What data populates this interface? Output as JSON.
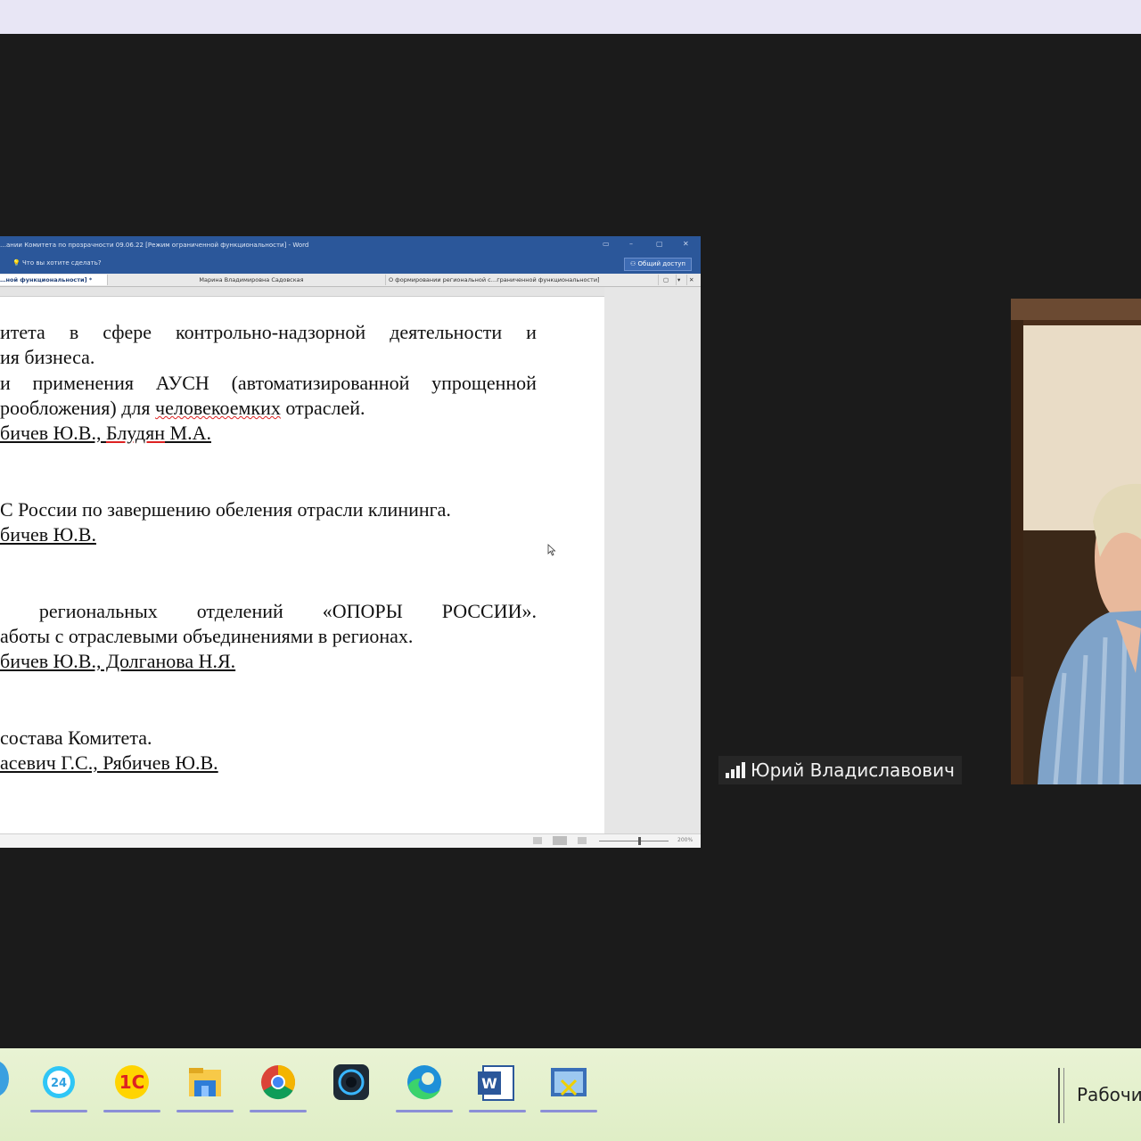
{
  "word": {
    "title": "…ании Комитета по прозрачности 09.06.22 [Режим ограниченной функциональности] - Word",
    "tell_me": "Что вы хотите сделать?",
    "share_label": "Общий доступ",
    "tabs": [
      "…ной функциональности] *",
      "Марина Владимировна Садовская",
      "О формировании региональной с…граниченной функциональности]"
    ],
    "zoom": "200%"
  },
  "document": {
    "lines": [
      {
        "parts": [
          "итета",
          "в",
          "сфере",
          "контрольно-надзорной",
          "деятельности",
          "и"
        ]
      },
      {
        "text": "ия бизнеса."
      },
      {
        "parts": [
          "и",
          "применения",
          "АУСН",
          "(автоматизированной",
          "упрощенной"
        ]
      },
      {
        "before": "рообложения) для ",
        "spell": "человекоемких",
        "after": " отраслей."
      },
      {
        "u1": "бичев Ю.В., ",
        "spell": "Блудян",
        "u2": " М.А."
      },
      {
        "text": "С России по завершению обеления отрасли клининга."
      },
      {
        "u1": "бичев Ю.В."
      },
      {
        "parts": [
          "",
          "региональных",
          "отделений",
          "«ОПОРЫ",
          "РОССИИ»."
        ]
      },
      {
        "text": "аботы с отраслевыми объединениями в регионах."
      },
      {
        "u1": "бичев Ю.В., Долганова Н.Я."
      },
      {
        "text": "состава Комитета."
      },
      {
        "u1": "асевич Г.С., Рябичев Ю.В."
      }
    ]
  },
  "participant": {
    "name": "Юрий Владиславович"
  },
  "taskbar": {
    "apps": [
      "bitrix24-icon",
      "1c-icon",
      "file-explorer-icon",
      "chrome-icon",
      "camera-app-icon",
      "edge-icon",
      "word-icon",
      "screenshot-tool-icon"
    ],
    "desktop_label": "Рабочий"
  }
}
